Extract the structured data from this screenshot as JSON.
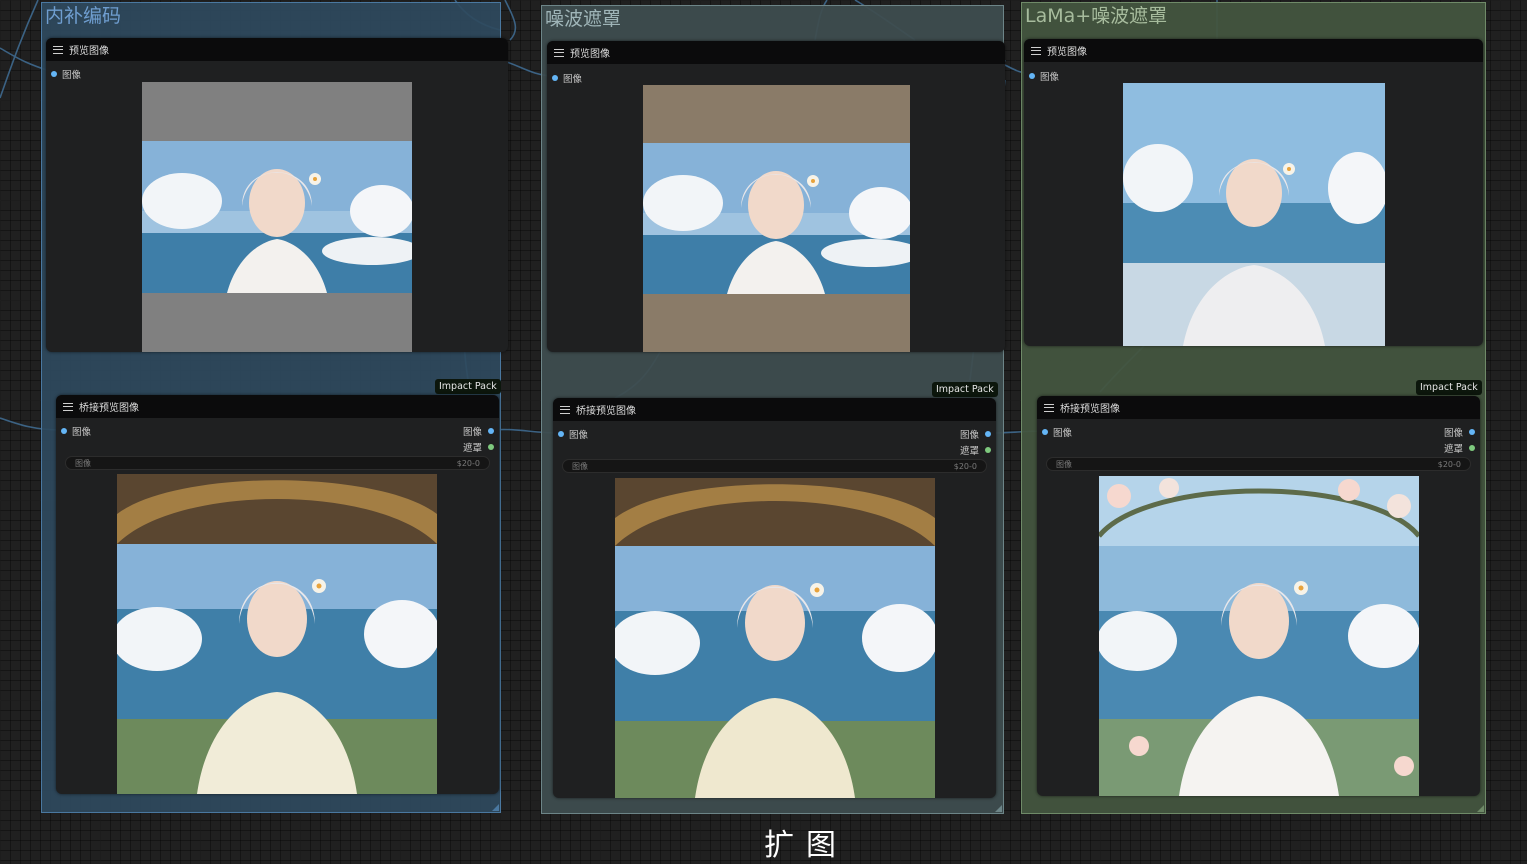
{
  "groups": [
    {
      "title": "内补编码",
      "bg": "#2f4a5e",
      "border": "#4a78a0",
      "title_color": "#6f9ed0"
    },
    {
      "title": "噪波遮罩",
      "bg": "#3e4d4f",
      "border": "#6d8588",
      "title_color": "#9fb5b8"
    },
    {
      "title": "LaMa+噪波遮罩",
      "bg": "#43553f",
      "border": "#6f8a68",
      "title_color": "#a7bc9d"
    }
  ],
  "preview_node": {
    "title": "预览图像",
    "input_label": "图像"
  },
  "bridge_node": {
    "title": "桥接预览图像",
    "input_label": "图像",
    "output_image_label": "图像",
    "output_mask_label": "遮罩",
    "widget_label": "图像",
    "widget_value": "$20-0"
  },
  "badge_text": "Impact Pack",
  "bottom_label": "扩图",
  "preview_pad_colors": [
    "#808080",
    "#8a7b68",
    ""
  ],
  "colors": {
    "slot_image": "#64b5f6",
    "slot_mask": "#7ec97e",
    "node_header": "#0b0b0c",
    "node_body": "#1f2021"
  }
}
